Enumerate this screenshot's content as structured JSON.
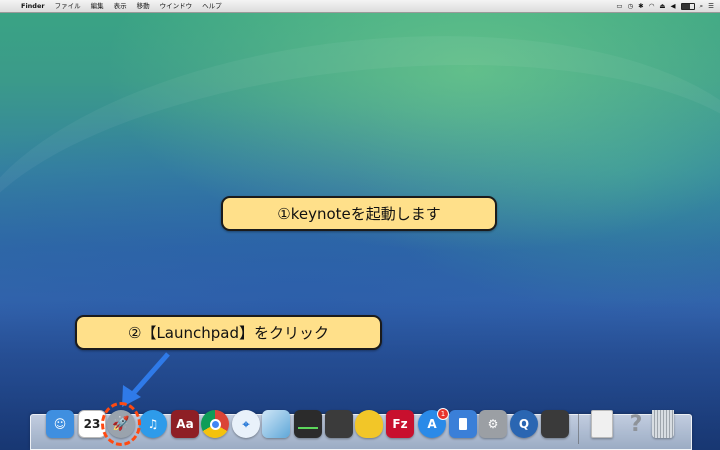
{
  "menubar": {
    "apple_glyph": "",
    "app_name": "Finder",
    "items": [
      "ファイル",
      "編集",
      "表示",
      "移動",
      "ウインドウ",
      "ヘルプ"
    ],
    "status_icons": [
      "airplay-icon",
      "time-machine-icon",
      "bluetooth-icon",
      "wifi-icon",
      "eject-icon",
      "volume-icon",
      "battery-icon",
      "search-icon",
      "notification-center-icon"
    ]
  },
  "callouts": {
    "step1": "①keynoteを起動します",
    "step2": "②【Launchpad】をクリック"
  },
  "dock": {
    "items": [
      {
        "name": "finder",
        "glyph": "☺",
        "color": "#3f8fe0"
      },
      {
        "name": "calendar",
        "glyph": "23",
        "color": "#ffffff"
      },
      {
        "name": "launchpad",
        "glyph": "🚀",
        "color": "#9aa3ad"
      },
      {
        "name": "itunes",
        "glyph": "♫",
        "color": "#2e9bea"
      },
      {
        "name": "dictionary",
        "glyph": "Aa",
        "color": "#8e1f25"
      },
      {
        "name": "chrome",
        "glyph": "",
        "color": "#ffffff"
      },
      {
        "name": "safari",
        "glyph": "⌖",
        "color": "#e9f1fa"
      },
      {
        "name": "preview",
        "glyph": "",
        "color": "#5fa7d8"
      },
      {
        "name": "activity-monitor",
        "glyph": "",
        "color": "#2b2b2b"
      },
      {
        "name": "final-cut",
        "glyph": "",
        "color": "#3b3b3b"
      },
      {
        "name": "cyberduck",
        "glyph": "",
        "color": "#f2c628"
      },
      {
        "name": "filezilla",
        "glyph": "Fz",
        "color": "#c8102e"
      },
      {
        "name": "app-store",
        "glyph": "A",
        "color": "#2a8ae8",
        "badge": "1"
      },
      {
        "name": "keynote",
        "glyph": "",
        "color": "#3a7fd8"
      },
      {
        "name": "system-preferences",
        "glyph": "⚙",
        "color": "#9b9fa4"
      },
      {
        "name": "quicktime",
        "glyph": "Q",
        "color": "#2a66b2"
      },
      {
        "name": "photo-booth",
        "glyph": "",
        "color": "#3a3a3a"
      },
      {
        "name": "document",
        "glyph": "",
        "color": "#f0f0f0"
      },
      {
        "name": "unknown",
        "glyph": "?",
        "color": "transparent"
      },
      {
        "name": "trash",
        "glyph": "",
        "color": "#c7ccd2"
      }
    ]
  }
}
